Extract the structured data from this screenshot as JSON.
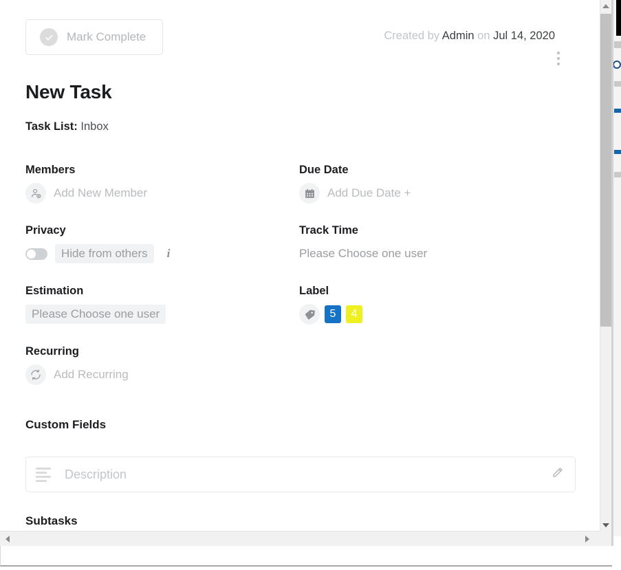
{
  "header": {
    "mark_complete_label": "Mark Complete",
    "created_prefix": "Created by",
    "created_by": "Admin",
    "created_on_word": "on",
    "created_date": "Jul 14, 2020",
    "menu_icon": "kebab-menu-icon"
  },
  "task": {
    "title": "New Task",
    "task_list_label": "Task List:",
    "task_list_value": "Inbox"
  },
  "fields": {
    "members": {
      "label": "Members",
      "placeholder": "Add New Member",
      "icon": "add-member-icon"
    },
    "due_date": {
      "label": "Due Date",
      "placeholder": "Add Due Date +",
      "icon": "calendar-icon"
    },
    "privacy": {
      "label": "Privacy",
      "toggle_label": "Hide from others",
      "toggle_state": "off",
      "info_icon": "info-icon"
    },
    "track_time": {
      "label": "Track Time",
      "value": "Please Choose one user"
    },
    "estimation": {
      "label": "Estimation",
      "value": "Please Choose one user"
    },
    "label": {
      "label": "Label",
      "icon": "tag-icon",
      "badges": [
        {
          "text": "5",
          "color": "#1572c4"
        },
        {
          "text": "4",
          "color": "#eef020"
        }
      ]
    },
    "recurring": {
      "label": "Recurring",
      "placeholder": "Add Recurring",
      "icon": "recurring-icon"
    }
  },
  "custom_fields": {
    "heading": "Custom Fields",
    "description_placeholder": "Description",
    "left_icon": "text-lines-icon",
    "edit_icon": "pencil-icon"
  },
  "subtasks": {
    "heading": "Subtasks"
  },
  "scrollbars": {
    "vertical_up_icon": "scroll-up-arrow-icon",
    "vertical_down_icon": "scroll-down-arrow-icon",
    "horizontal_left_icon": "scroll-left-arrow-icon",
    "horizontal_right_icon": "scroll-right-arrow-icon"
  }
}
